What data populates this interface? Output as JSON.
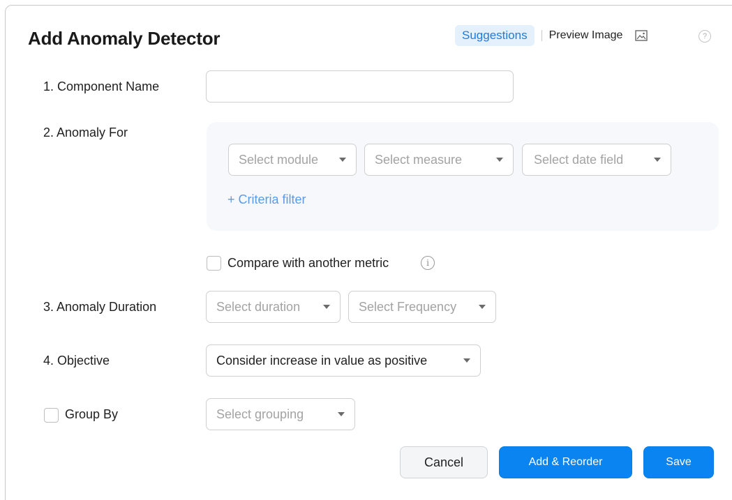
{
  "dialog": {
    "title": "Add Anomaly Detector",
    "suggestions_label": "Suggestions",
    "preview_label": "Preview Image",
    "help_glyph": "?"
  },
  "fields": {
    "component_name_label": "1. Component Name",
    "component_name_value": "",
    "anomaly_for_label": "2. Anomaly For",
    "module_placeholder": "Select module",
    "measure_placeholder": "Select measure",
    "date_field_placeholder": "Select date field",
    "criteria_filter": "+ Criteria filter",
    "compare_label": "Compare with another metric",
    "info_glyph": "i",
    "duration_label": "3. Anomaly Duration",
    "duration_placeholder": "Select duration",
    "frequency_placeholder": "Select Frequency",
    "objective_label": "4. Objective",
    "objective_value": "Consider increase in value as positive",
    "group_by_label": "Group By",
    "grouping_placeholder": "Select grouping"
  },
  "buttons": {
    "cancel": "Cancel",
    "add_reorder": "Add & Reorder",
    "save": "Save"
  },
  "colors": {
    "primary": "#0a84f0",
    "accent_link": "#1c7ce0",
    "panel_bg": "#f6f8fc"
  },
  "icons": {
    "preview": "image-icon",
    "help": "help-icon",
    "info": "info-icon",
    "dropdown": "caret-down-icon"
  }
}
